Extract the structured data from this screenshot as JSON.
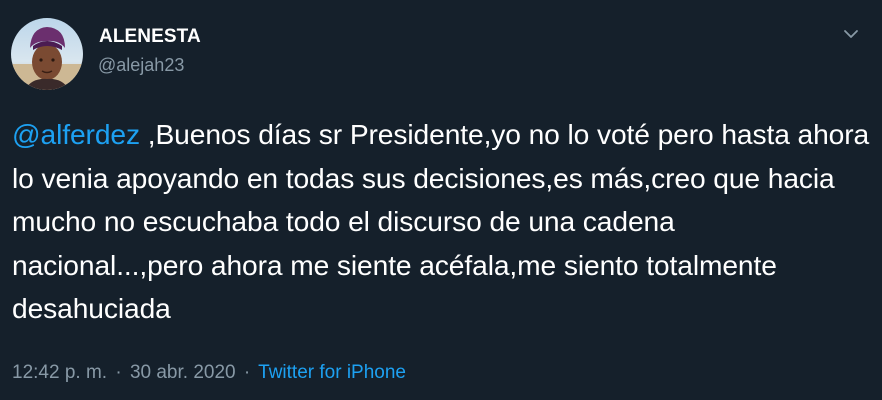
{
  "author": {
    "display_name": "ALENESTA",
    "handle": "@alejah23"
  },
  "tweet": {
    "mention": "@alferdez",
    "body": " ,Buenos días sr Presidente,yo no lo voté pero hasta ahora lo venia apoyando en todas sus decisiones,es más,creo que hacia mucho no escuchaba todo el discurso de una cadena nacional...,pero ahora me siente acéfala,me siento totalmente desahuciada"
  },
  "meta": {
    "time": "12:42 p. m.",
    "separator": "·",
    "date": "30 abr. 2020",
    "source": "Twitter for iPhone"
  },
  "colors": {
    "background": "#15202b",
    "accent": "#1da1f2",
    "secondary_text": "#8899a6"
  },
  "icons": {
    "menu": "chevron-down-icon"
  }
}
